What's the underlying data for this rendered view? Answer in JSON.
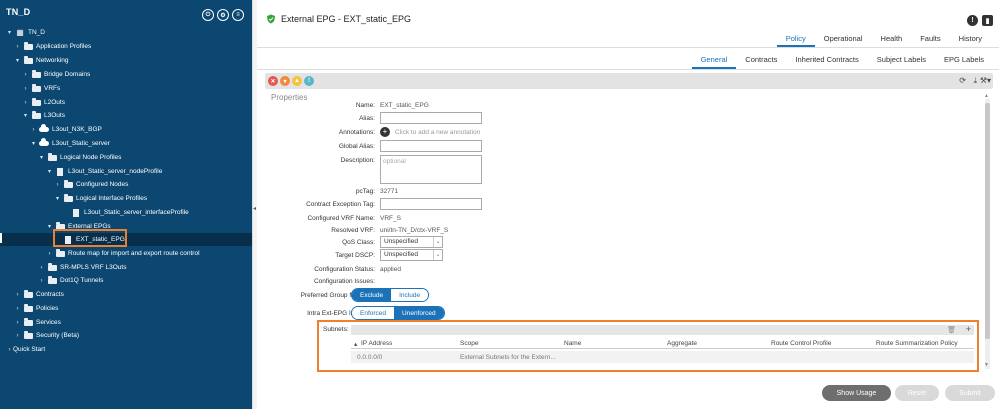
{
  "sidebar": {
    "title": "TN_D",
    "tree": [
      {
        "label": "TN_D",
        "icon": "tenant-icon",
        "twisty": "▾"
      },
      {
        "label": "Application Profiles",
        "icon": "folder-icon",
        "twisty": "›"
      },
      {
        "label": "Networking",
        "icon": "folder-icon",
        "twisty": "▾"
      },
      {
        "label": "Bridge Domains",
        "icon": "folder-icon",
        "twisty": "›"
      },
      {
        "label": "VRFs",
        "icon": "folder-icon",
        "twisty": "›"
      },
      {
        "label": "L2Outs",
        "icon": "folder-icon",
        "twisty": "›"
      },
      {
        "label": "L3Outs",
        "icon": "folder-icon",
        "twisty": "▾"
      },
      {
        "label": "L3out_N3K_BGP",
        "icon": "cloud-icon",
        "twisty": "›"
      },
      {
        "label": "L3out_Static_server",
        "icon": "cloud-icon",
        "twisty": "▾"
      },
      {
        "label": "Logical Node Profiles",
        "icon": "folder-icon",
        "twisty": "▾"
      },
      {
        "label": "L3out_Static_server_nodeProfile",
        "icon": "document-icon",
        "twisty": "▾"
      },
      {
        "label": "Configured Nodes",
        "icon": "folder-icon",
        "twisty": "›"
      },
      {
        "label": "Logical Interface Profiles",
        "icon": "folder-icon",
        "twisty": "▾"
      },
      {
        "label": "L3out_Static_server_interfaceProfile",
        "icon": "document-icon",
        "twisty": ""
      },
      {
        "label": "External EPGs",
        "icon": "folder-icon",
        "twisty": "▾"
      },
      {
        "label": "EXT_static_EPG",
        "icon": "document-icon",
        "twisty": ""
      },
      {
        "label": "Route map for import and export route control",
        "icon": "folder-icon",
        "twisty": "›"
      },
      {
        "label": "SR-MPLS VRF L3Outs",
        "icon": "folder-icon",
        "twisty": "›"
      },
      {
        "label": "Dot1Q Tunnels",
        "icon": "folder-icon",
        "twisty": "›"
      },
      {
        "label": "Contracts",
        "icon": "folder-icon",
        "twisty": "›"
      },
      {
        "label": "Policies",
        "icon": "folder-icon",
        "twisty": "›"
      },
      {
        "label": "Services",
        "icon": "folder-icon",
        "twisty": "›"
      },
      {
        "label": "Security (Beta)",
        "icon": "folder-icon",
        "twisty": "›"
      },
      {
        "label": "Quick Start",
        "icon": "play-icon",
        "twisty": "›"
      }
    ]
  },
  "header": {
    "title": "External EPG - EXT_static_EPG",
    "top_tabs": [
      "Policy",
      "Operational",
      "Health",
      "Faults",
      "History"
    ],
    "active_top_tab": "Policy",
    "sub_tabs": [
      "General",
      "Contracts",
      "Inherited Contracts",
      "Subject Labels",
      "EPG Labels"
    ],
    "active_sub_tab": "General"
  },
  "properties": {
    "heading": "Properties",
    "name_label": "Name:",
    "name_value": "EXT_static_EPG",
    "alias_label": "Alias:",
    "annotations_label": "Annotations:",
    "annotations_placeholder": "Click to add a new annotation",
    "global_alias_label": "Global Alias:",
    "description_label": "Description:",
    "description_placeholder": "optional",
    "pctag_label": "pcTag:",
    "pctag_value": "32771",
    "contract_exception_label": "Contract Exception Tag:",
    "configured_vrf_label": "Configured VRF Name:",
    "configured_vrf_value": "VRF_S",
    "resolved_vrf_label": "Resolved VRF:",
    "resolved_vrf_value": "uni/tn-TN_D/ctx-VRF_S",
    "qos_label": "QoS Class:",
    "qos_value": "Unspecified",
    "target_dscp_label": "Target DSCP:",
    "target_dscp_value": "Unspecified",
    "config_status_label": "Configuration Status:",
    "config_status_value": "applied",
    "config_issues_label": "Configuration Issues:",
    "preferred_group_label": "Preferred Group Member:",
    "preferred_group_options": [
      "Exclude",
      "Include"
    ],
    "preferred_group_selected": "Exclude",
    "intra_isolation_label": "Intra Ext-EPG Isolation:",
    "intra_isolation_options": [
      "Enforced",
      "Unenforced"
    ],
    "intra_isolation_selected": "Unenforced"
  },
  "subnets": {
    "label": "Subnets:",
    "columns": [
      "IP Address",
      "Scope",
      "Name",
      "Aggregate",
      "Route Control Profile",
      "Route Summarization Policy"
    ],
    "rows": [
      {
        "ip": "0.0.0.0/0",
        "scope": "External Subnets for the Extern...",
        "name": "",
        "aggregate": "",
        "rcp": "",
        "rsp": ""
      }
    ]
  },
  "buttons": {
    "show_usage": "Show Usage",
    "reset": "Reset",
    "submit": "Submit"
  },
  "colors": {
    "sidebar_bg": "#0b4770",
    "accent": "#1b72b9",
    "highlight": "#ee7f2d"
  }
}
